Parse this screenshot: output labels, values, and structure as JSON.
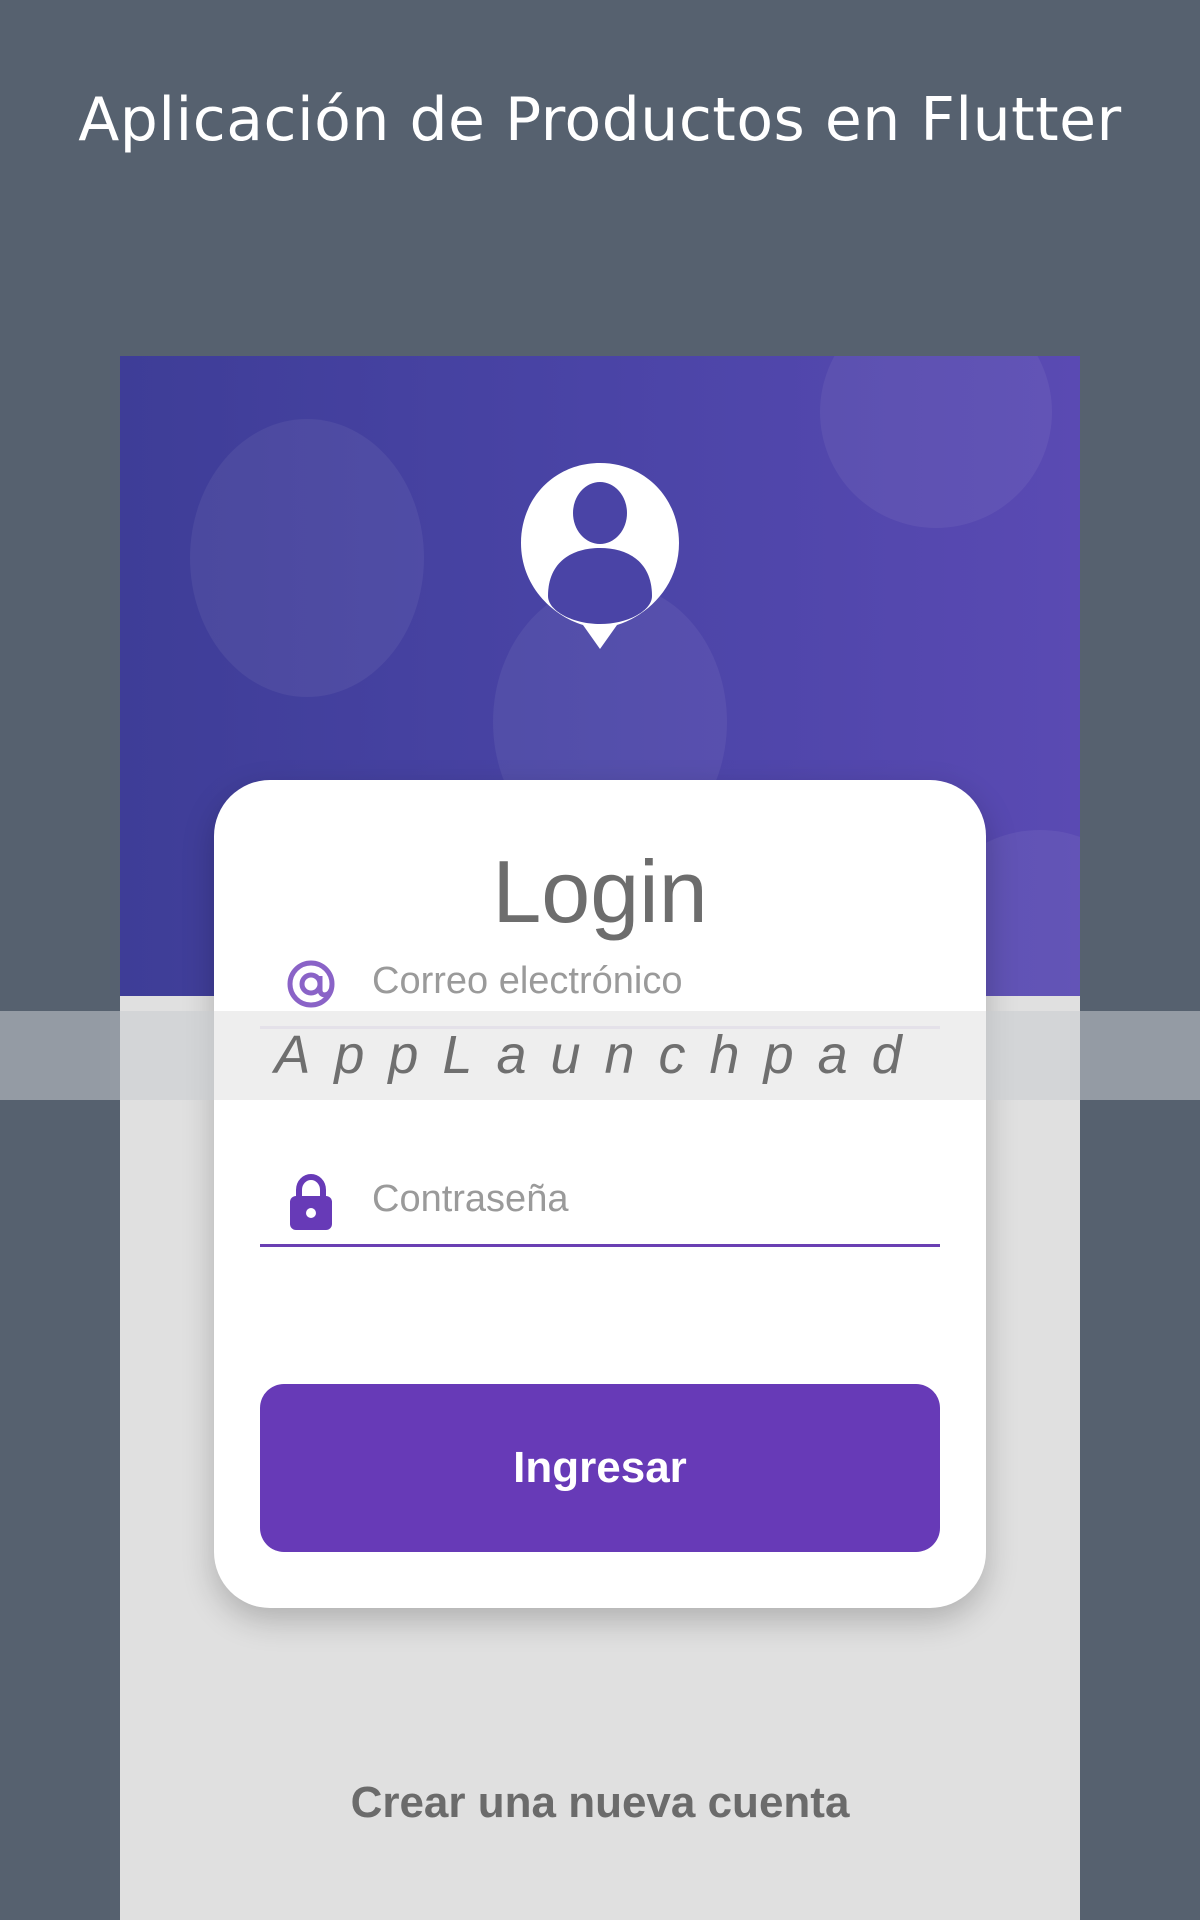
{
  "headline": "Aplicación de Productos en Flutter",
  "login": {
    "title": "Login",
    "email_placeholder": "Correo electrónico",
    "password_placeholder": "Contraseña",
    "submit_label": "Ingresar",
    "create_account_label": "Crear una nueva cuenta"
  },
  "watermark": {
    "text": "AppLaunchpad"
  },
  "icons": {
    "avatar": "person-pin-icon",
    "email": "at-sign-icon",
    "password": "lock-icon"
  },
  "colors": {
    "page_background": "#56616f",
    "hero_gradient_start": "#3e3d97",
    "hero_gradient_end": "#5a4ab3",
    "accent": "#673ab7",
    "card_background": "#ffffff",
    "screen_background": "#e0e0e0"
  }
}
